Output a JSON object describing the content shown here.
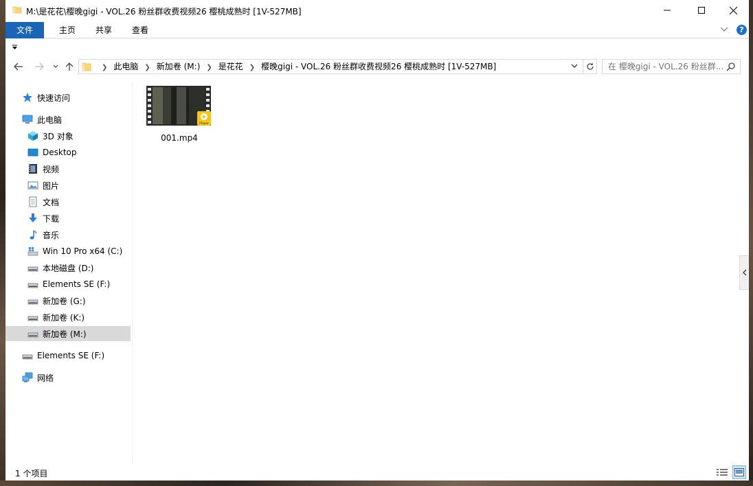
{
  "window": {
    "title": "M:\\是花花\\樱晚gigi - VOL.26 粉丝群收费视频26 樱桃成熟时 [1V-527MB]"
  },
  "ribbon": {
    "tabs": [
      "文件",
      "主页",
      "共享",
      "查看"
    ],
    "help": "?"
  },
  "address": {
    "crumbs": [
      "此电脑",
      "新加卷 (M:)",
      "是花花",
      "樱晚gigi - VOL.26 粉丝群收费视频26 樱桃成熟时 [1V-527MB]"
    ]
  },
  "search": {
    "placeholder": "在 樱晚gigi - VOL.26 粉丝群..."
  },
  "nav_pane": {
    "items": [
      {
        "label": "快速访问",
        "icon": "star-icon"
      },
      {
        "label": "此电脑",
        "icon": "computer-icon"
      },
      {
        "label": "3D 对象",
        "icon": "cube-icon"
      },
      {
        "label": "Desktop",
        "icon": "desktop-icon"
      },
      {
        "label": "视频",
        "icon": "video-icon"
      },
      {
        "label": "图片",
        "icon": "picture-icon"
      },
      {
        "label": "文档",
        "icon": "document-icon"
      },
      {
        "label": "下载",
        "icon": "download-icon"
      },
      {
        "label": "音乐",
        "icon": "music-icon"
      },
      {
        "label": "Win 10 Pro x64 (C:)",
        "icon": "windows-drive-icon"
      },
      {
        "label": "本地磁盘 (D:)",
        "icon": "drive-icon"
      },
      {
        "label": "Elements SE (F:)",
        "icon": "drive-icon"
      },
      {
        "label": "新加卷 (G:)",
        "icon": "drive-icon"
      },
      {
        "label": "新加卷 (K:)",
        "icon": "drive-icon"
      },
      {
        "label": "新加卷 (M:)",
        "icon": "drive-icon"
      },
      {
        "label": "Elements SE (F:)",
        "icon": "usb-drive-icon"
      },
      {
        "label": "网络",
        "icon": "network-icon"
      }
    ],
    "selected": "新加卷 (M:)"
  },
  "files": [
    {
      "name": "001.mp4",
      "badge": "Player"
    }
  ],
  "status": {
    "item_count": "1 个项目"
  },
  "colors": {
    "accent": "#1a65b5",
    "selected": "#d9d9d9",
    "folder": "#f8d775"
  }
}
